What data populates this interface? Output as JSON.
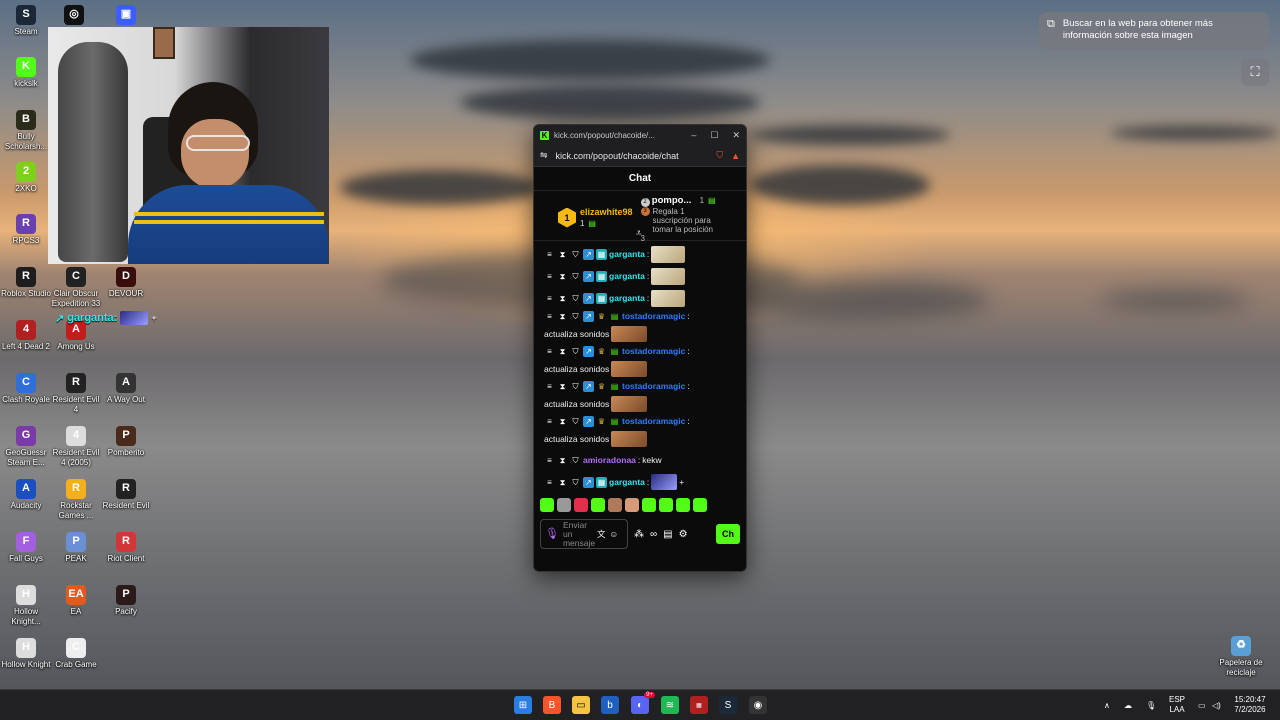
{
  "desktop": {
    "icons": [
      {
        "label": "Steam",
        "glyph": "S",
        "color": "#1b2838"
      },
      {
        "label": "",
        "glyph": "◎",
        "color": "#111"
      },
      {
        "label": "",
        "glyph": "▣",
        "color": "#3b5cff"
      },
      {
        "label": "kickslk",
        "glyph": "K",
        "color": "#53fc18"
      },
      {
        "label": "Bully Scholarsh...",
        "glyph": "B",
        "color": "#2b2b1a"
      },
      {
        "label": "2XKO",
        "glyph": "2",
        "color": "#7fcf1f"
      },
      {
        "label": "RPCS3",
        "glyph": "R",
        "color": "#6a3fb0"
      },
      {
        "label": "Roblox Studio",
        "glyph": "R",
        "color": "#1e1e1e"
      },
      {
        "label": "Clair Obscur Expedition 33",
        "glyph": "C",
        "color": "#222"
      },
      {
        "label": "DEVOUR",
        "glyph": "D",
        "color": "#3a0d0d"
      },
      {
        "label": "Left 4 Dead 2",
        "glyph": "4",
        "color": "#b02020"
      },
      {
        "label": "Among Us",
        "glyph": "A",
        "color": "#c21d1d"
      },
      {
        "label": "Clash Royale",
        "glyph": "C",
        "color": "#2f6fd6"
      },
      {
        "label": "Resident Evil 4",
        "glyph": "R",
        "color": "#222"
      },
      {
        "label": "A Way Out",
        "glyph": "A",
        "color": "#333"
      },
      {
        "label": "GeoGuessr Steam E...",
        "glyph": "G",
        "color": "#7a3aa8"
      },
      {
        "label": "Resident Evil 4 (2005)",
        "glyph": "4",
        "color": "#ddd"
      },
      {
        "label": "Pomberito",
        "glyph": "P",
        "color": "#4a2a1a"
      },
      {
        "label": "Audacity",
        "glyph": "A",
        "color": "#1b4fbf"
      },
      {
        "label": "Rockstar Games ...",
        "glyph": "R",
        "color": "#f3b01b"
      },
      {
        "label": "Resident Evil",
        "glyph": "R",
        "color": "#222"
      },
      {
        "label": "Fall Guys",
        "glyph": "F",
        "color": "#a45ee0"
      },
      {
        "label": "PEAK",
        "glyph": "P",
        "color": "#6b8fd4"
      },
      {
        "label": "Riot Client",
        "glyph": "R",
        "color": "#d13639"
      },
      {
        "label": "Hollow Knight...",
        "glyph": "H",
        "color": "#ddd"
      },
      {
        "label": "EA",
        "glyph": "EA",
        "color": "#e25a1c"
      },
      {
        "label": "Pacify",
        "glyph": "P",
        "color": "#2a1a1a"
      },
      {
        "label": "Hollow Knight",
        "glyph": "H",
        "color": "#ddd"
      },
      {
        "label": "Crab Game",
        "glyph": "C",
        "color": "#eee"
      },
      {
        "label": "Papelera de reciclaje",
        "glyph": "♻",
        "color": "#5aa0d6"
      }
    ]
  },
  "overlay": {
    "chat_user": "garganta:",
    "plus": "+"
  },
  "lens": {
    "tooltip": "Buscar en la web para obtener más información sobre esta imagen"
  },
  "popup": {
    "tab_title": "kick.com/popout/chacoide/...",
    "url": "kick.com/popout/chacoide/chat",
    "header": "Chat",
    "gift_left_rank": "1",
    "gift_left_user": "elizawhite98",
    "gift_left_count": "1",
    "gift_right_rank": "2",
    "gift_right_rank2": "3",
    "gift_right_user": "pompo...",
    "gift_right_count": "1",
    "gift_right_text": "Regala 1 suscripción para tomar la posición",
    "gift_right_more": "3",
    "messages": [
      {
        "user": "garganta",
        "text": "",
        "color": "teal",
        "emote": "badge"
      },
      {
        "user": "garganta",
        "text": "",
        "color": "teal",
        "emote": "badge"
      },
      {
        "user": "garganta",
        "text": "",
        "color": "teal",
        "emote": "badge"
      },
      {
        "user": "tostadoramagic",
        "text": "actualiza sonidos",
        "color": "blue",
        "emote": "cat"
      },
      {
        "user": "tostadoramagic",
        "text": "actualiza sonidos",
        "color": "blue",
        "emote": "cat"
      },
      {
        "user": "tostadoramagic",
        "text": "actualiza sonidos",
        "color": "blue",
        "emote": "cat"
      },
      {
        "user": "tostadoramagic",
        "text": "actualiza sonidos",
        "color": "blue",
        "emote": "cat"
      },
      {
        "user": "amioradonaa",
        "text": "kekw",
        "color": "purple",
        "emote": ""
      },
      {
        "user": "garganta",
        "text": "",
        "color": "teal",
        "emote": "dark"
      }
    ],
    "input_placeholder": "Enviar un mensaje",
    "send_label": "Ch"
  },
  "taskbar": {
    "lang_top": "ESP",
    "lang_bottom": "LAA",
    "time": "15:20:47",
    "date": "7/2/2026",
    "discord_badge": "9+"
  }
}
